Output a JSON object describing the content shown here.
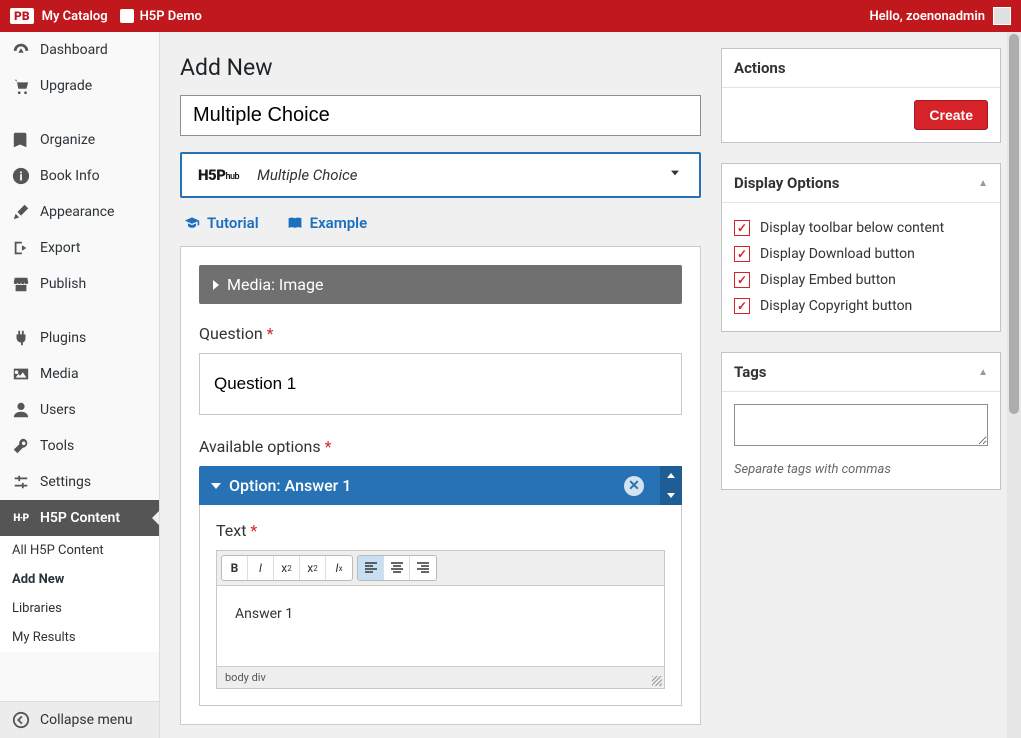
{
  "topbar": {
    "logo": "PB",
    "catalog": "My Catalog",
    "book_title": "H5P Demo",
    "greeting": "Hello, zoenonadmin"
  },
  "sidebar": {
    "items_a": [
      {
        "id": "dashboard",
        "label": "Dashboard",
        "icon": "gauge"
      },
      {
        "id": "upgrade",
        "label": "Upgrade",
        "icon": "cart"
      }
    ],
    "items_b": [
      {
        "id": "organize",
        "label": "Organize",
        "icon": "book"
      },
      {
        "id": "bookinfo",
        "label": "Book Info",
        "icon": "info"
      },
      {
        "id": "appearance",
        "label": "Appearance",
        "icon": "brush"
      },
      {
        "id": "export",
        "label": "Export",
        "icon": "export"
      },
      {
        "id": "publish",
        "label": "Publish",
        "icon": "store"
      }
    ],
    "items_c": [
      {
        "id": "plugins",
        "label": "Plugins",
        "icon": "plug"
      },
      {
        "id": "media",
        "label": "Media",
        "icon": "media"
      },
      {
        "id": "users",
        "label": "Users",
        "icon": "user"
      },
      {
        "id": "tools",
        "label": "Tools",
        "icon": "wrench"
      },
      {
        "id": "settings",
        "label": "Settings",
        "icon": "sliders"
      }
    ],
    "current": {
      "label": "H5P Content",
      "prefix": "H·P"
    },
    "submenu": [
      {
        "label": "All H5P Content",
        "active": false
      },
      {
        "label": "Add New",
        "active": true
      },
      {
        "label": "Libraries",
        "active": false
      },
      {
        "label": "My Results",
        "active": false
      }
    ],
    "collapse": "Collapse menu"
  },
  "page": {
    "title": "Add New",
    "content_title": "Multiple Choice",
    "hub_logo_main": "H5P",
    "hub_logo_sub": "hub",
    "hub_type": "Multiple Choice",
    "tutorial": "Tutorial",
    "example": "Example"
  },
  "form": {
    "media_bar": "Media: Image",
    "question_label": "Question",
    "question_value": "Question 1",
    "options_label": "Available options",
    "option_head": "Option: Answer 1",
    "text_label": "Text",
    "answer_value": "Answer 1",
    "editor_path": "body   div"
  },
  "side": {
    "actions_title": "Actions",
    "create_btn": "Create",
    "display_title": "Display Options",
    "display_opts": [
      "Display toolbar below content",
      "Display Download button",
      "Display Embed button",
      "Display Copyright button"
    ],
    "tags_title": "Tags",
    "tags_hint": "Separate tags with commas"
  }
}
